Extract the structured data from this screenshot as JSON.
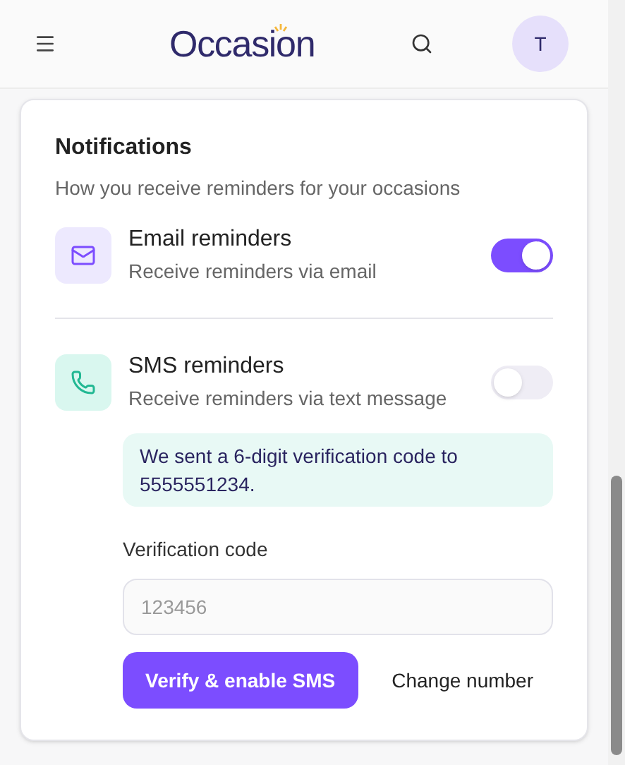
{
  "header": {
    "logo": "Occasion",
    "avatar": "T"
  },
  "notifications": {
    "title": "Notifications",
    "subtitle": "How you receive reminders for your occasions",
    "channels": [
      {
        "kind": "email",
        "name": "Email reminders",
        "description": "Receive reminders via email",
        "on": true
      },
      {
        "kind": "sms",
        "name": "SMS reminders",
        "description": "Receive reminders via text message",
        "on": false
      }
    ],
    "verification": {
      "message": "We sent a 6-digit verification code to 5555551234.",
      "label": "Verification code",
      "placeholder": "123456",
      "verify_button": "Verify & enable SMS",
      "change_button": "Change number"
    }
  }
}
